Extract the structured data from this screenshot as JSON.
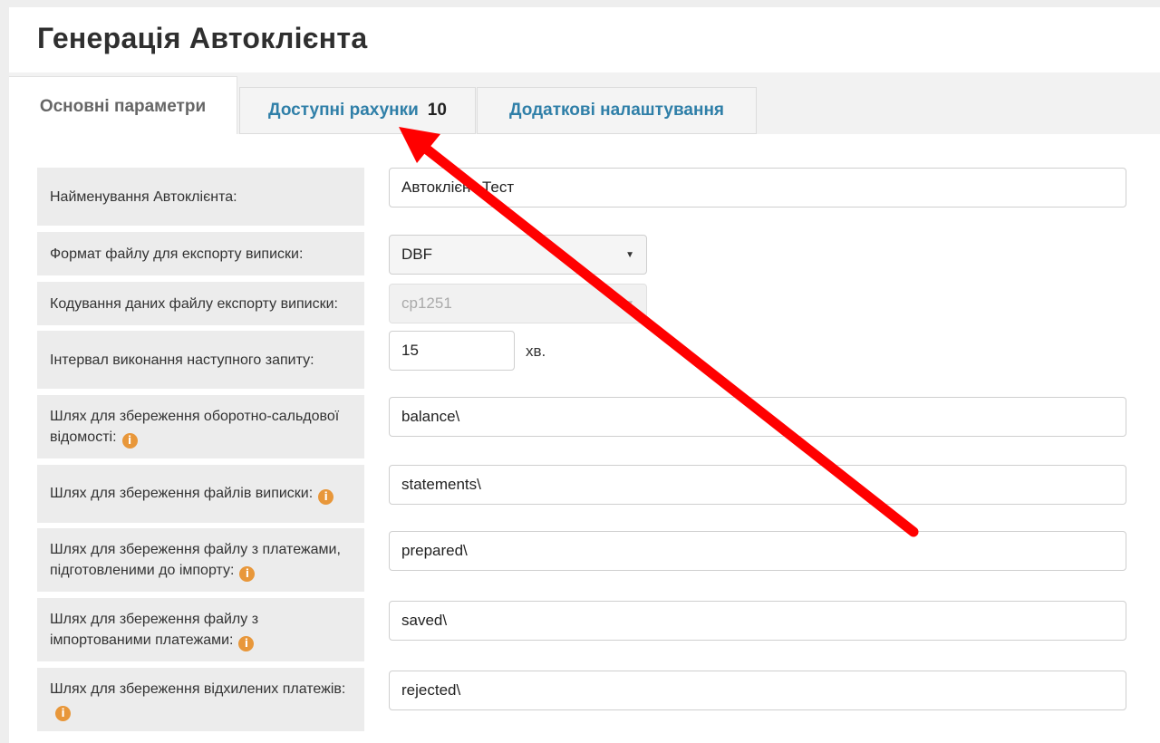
{
  "page": {
    "title": "Генерація Автоклієнта"
  },
  "tabs": [
    {
      "label": "Основні параметри"
    },
    {
      "label": "Доступні рахунки",
      "count": "10"
    },
    {
      "label": "Додаткові налаштування"
    }
  ],
  "form": {
    "name": {
      "label": "Найменування Автоклієнта:",
      "value": "Автоклієнт Тест"
    },
    "format": {
      "label": "Формат файлу для експорту виписки:",
      "value": "DBF"
    },
    "encoding": {
      "label": "Кодування даних файлу експорту виписки:",
      "value": "cp1251"
    },
    "interval": {
      "label": "Інтервал виконання наступного запиту:",
      "value": "15",
      "unit": "хв."
    },
    "balance_path": {
      "label": "Шлях для збереження оборотно-сальдової відомості:",
      "value": "balance\\"
    },
    "statements_path": {
      "label": "Шлях для збереження файлів виписки:",
      "value": "statements\\"
    },
    "prepared_path": {
      "label": "Шлях для збереження файлу з платежами, підготовленими до імпорту:",
      "value": "prepared\\"
    },
    "saved_path": {
      "label": "Шлях для збереження файлу з імпортованими платежами:",
      "value": "saved\\"
    },
    "rejected_path": {
      "label": "Шлях для збереження відхилених платежів:",
      "value": "rejected\\"
    }
  },
  "icons": {
    "info": "info-icon",
    "dropdown": "caret-down-icon",
    "annotation": "red-arrow"
  },
  "colors": {
    "tab_link": "#2f7fa8",
    "info_icon": "#e8973a",
    "annotation_arrow": "#ff0000"
  }
}
